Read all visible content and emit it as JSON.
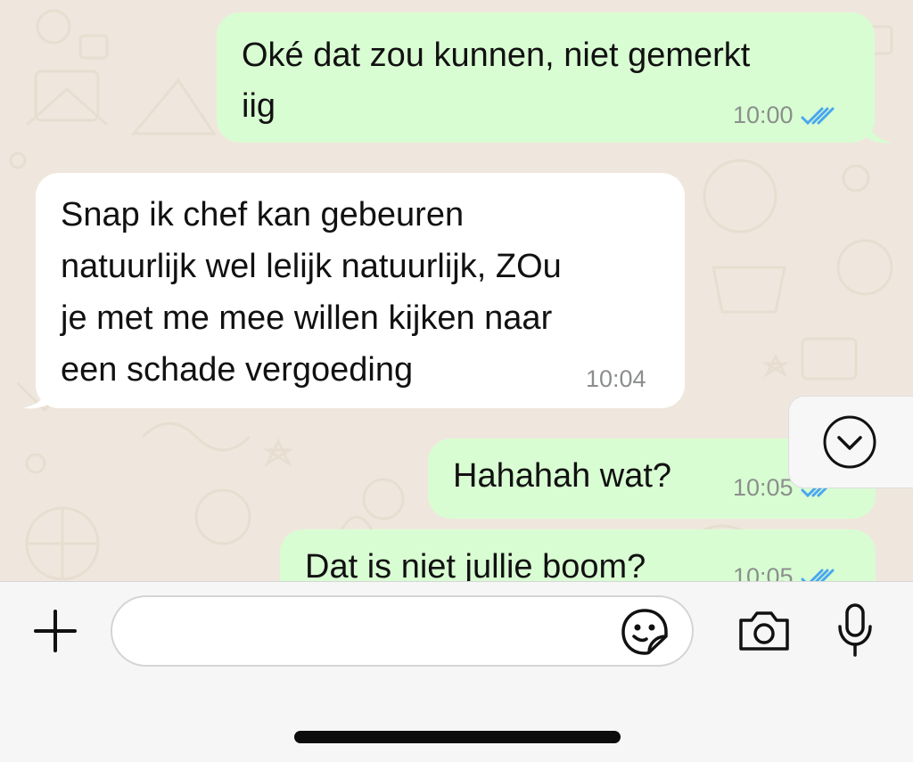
{
  "chat": {
    "messages": [
      {
        "direction": "outgoing",
        "lines": [
          "Oké dat zou kunnen, niet gemerkt",
          "iig"
        ],
        "time": "10:00",
        "status": "read"
      },
      {
        "direction": "incoming",
        "lines": [
          "Snap ik chef kan gebeuren",
          "natuurlijk wel lelijk natuurlijk, ZOu",
          "je met me mee willen kijken naar",
          "een schade vergoeding"
        ],
        "time": "10:04"
      },
      {
        "direction": "outgoing",
        "lines": [
          "Hahahah wat?"
        ],
        "time": "10:05",
        "status": "read"
      },
      {
        "direction": "outgoing",
        "lines": [
          "Dat is niet jullie boom?"
        ],
        "time": "10:05",
        "status": "read"
      }
    ],
    "scroll_down_icon": "chevron-down-circle-icon"
  },
  "composer": {
    "attach_icon": "plus-icon",
    "message_value": "",
    "sticker_icon": "sticker-icon",
    "camera_icon": "camera-icon",
    "mic_icon": "microphone-icon"
  },
  "colors": {
    "outgoing_bubble": "#d9fdd3",
    "incoming_bubble": "#ffffff",
    "wallpaper": "#efe7dd",
    "read_ticks": "#4aa7ee",
    "time_text": "#8b8f8c"
  }
}
